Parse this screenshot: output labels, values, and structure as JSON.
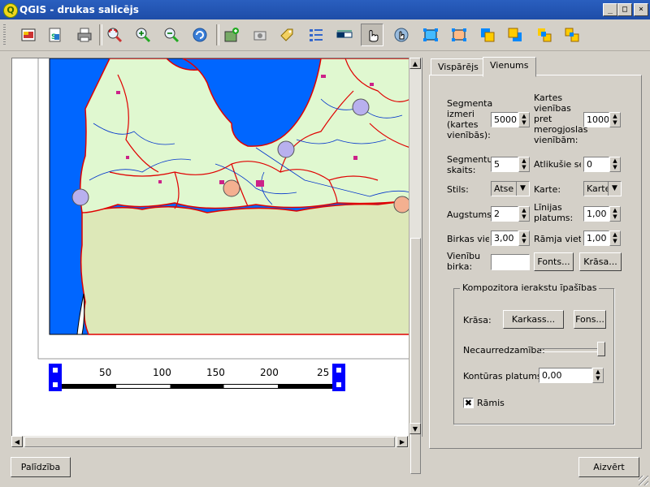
{
  "window": {
    "title": "QGIS - drukas salicējs",
    "logo_letter": "Q",
    "min": "_",
    "max": "□",
    "close": "×"
  },
  "toolbar": {
    "icons": [
      "add-map-icon",
      "export-svg-icon",
      "print-icon",
      "zoom-full-icon",
      "zoom-in-icon",
      "zoom-out-icon",
      "refresh-icon",
      "add-new-map-icon",
      "add-image-icon",
      "add-label-icon",
      "add-legend-icon",
      "add-scalebar-icon",
      "select-move-icon",
      "move-content-icon",
      "group-icon",
      "ungroup-icon",
      "raise-icon",
      "lower-icon",
      "bring-top-icon",
      "send-bottom-icon"
    ]
  },
  "scalebar": {
    "labels": [
      "50",
      "100",
      "150",
      "200",
      "25"
    ]
  },
  "map": {
    "colors": {
      "water": "#0066ff",
      "land": "#e0f8d0",
      "foreign": "#dde8b8",
      "border": "#e00000",
      "river": "#0033cc"
    }
  },
  "tabs": {
    "general": "Vispārējs",
    "item": "Vienums"
  },
  "form": {
    "segment_size_label": "Segmenta izmeri (kartes vienībās):",
    "segment_size_value": "5000",
    "map_units_label": "Kartes vienības pret merogjoslas vienībām:",
    "map_units_value": "1000",
    "segments_label": "Segmentu skaits:",
    "segments_value": "5",
    "remaining_label": "Atlikušie se",
    "remaining_value": "0",
    "style_label": "Stils:",
    "style_value": "Atse",
    "map_label": "Karte:",
    "map_value": "Karte",
    "height_label": "Augstums",
    "height_value": "2",
    "line_width_label": "Līnijas platums:",
    "line_width_value": "1,00",
    "label_space_label": "Birkas viet",
    "label_space_value": "3,00",
    "box_space_label": "Rāmja vieta",
    "box_space_value": "1,00",
    "unit_label_label": "Vienību birka:",
    "unit_label_value": "",
    "font_button": "Fonts...",
    "color_button": "Krāsa..."
  },
  "composer": {
    "title": "Kompozitora ierakstu īpašības",
    "color_label": "Krāsa:",
    "frame_button": "Karkass...",
    "background_button": "Fons...",
    "opacity_label": "Necaurredzamība:",
    "opacity_value": 1.0,
    "outline_label": "Kontūras platums",
    "outline_value": "0,00",
    "frame_check_label": "Rāmis",
    "frame_checked": "✖"
  },
  "footer": {
    "help": "Palīdzība",
    "close": "Aizvērt"
  }
}
